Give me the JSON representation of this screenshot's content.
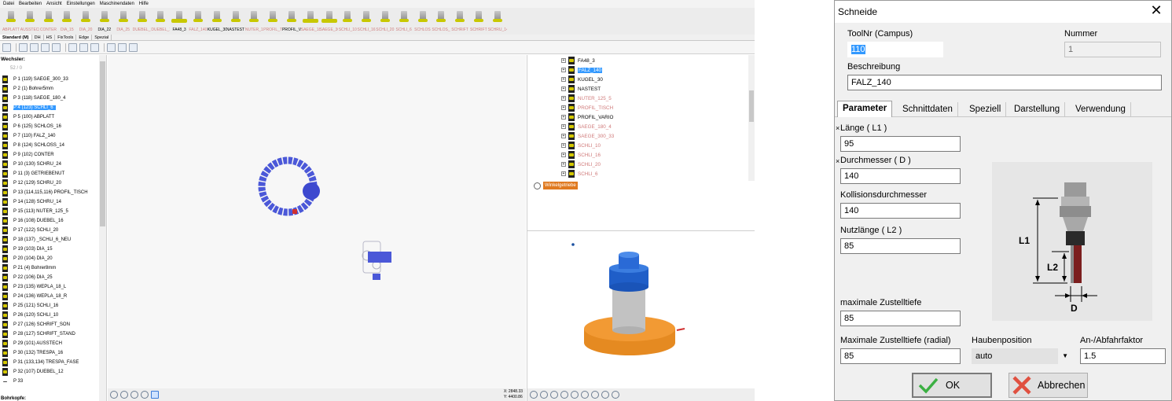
{
  "menubar": [
    "Datei",
    "Bearbeiten",
    "Ansicht",
    "Einstellungen",
    "Maschinendaten",
    "Hilfe"
  ],
  "toolstrip": [
    {
      "label": "ABPLATT",
      "dark": false
    },
    {
      "label": "AUSSTECH",
      "dark": false
    },
    {
      "label": "CONTER",
      "dark": false
    },
    {
      "label": "DIA_15",
      "dark": false
    },
    {
      "label": "DIA_20",
      "dark": false
    },
    {
      "label": "DIA_22",
      "dark": true
    },
    {
      "label": "DIA_25",
      "dark": false
    },
    {
      "label": "DUEBEL_12",
      "dark": false
    },
    {
      "label": "DUEBEL_16",
      "dark": false
    },
    {
      "label": "FA48_3",
      "dark": true
    },
    {
      "label": "FALZ_140",
      "dark": false
    },
    {
      "label": "KUGEL_30",
      "dark": true
    },
    {
      "label": "NASTEST",
      "dark": true
    },
    {
      "label": "NUTER_1",
      "dark": false
    },
    {
      "label": "PROFIL_TI",
      "dark": false
    },
    {
      "label": "PROFIL_V",
      "dark": true
    },
    {
      "label": "SAEGE_18",
      "dark": false
    },
    {
      "label": "SAEGE_30",
      "dark": false
    },
    {
      "label": "SCHLI_10",
      "dark": false
    },
    {
      "label": "SCHLI_16",
      "dark": false
    },
    {
      "label": "SCHLI_20",
      "dark": false
    },
    {
      "label": "SCHLI_6",
      "dark": false
    },
    {
      "label": "SCHLOS",
      "dark": false
    },
    {
      "label": "SCHLOS_16",
      "dark": false
    },
    {
      "label": "SCHRIFT",
      "dark": false
    },
    {
      "label": "SCHRIFT",
      "dark": false
    },
    {
      "label": "SCHRU_14",
      "dark": false
    }
  ],
  "tabrow": [
    "Standard (M)",
    "DH",
    "HS",
    "FixTools",
    "Edge",
    "Spezial"
  ],
  "left_panel": {
    "title": "Wechsler:",
    "subtitle": "52 / 0",
    "footer": "Bohrkopfe:",
    "slots": [
      "P 1 (119) SAEGE_300_33",
      "P 2 (1) Bohrer5mm",
      "P 3 (118) SAEGE_180_4",
      "P 4 (123) SCHLI_6",
      "P 5 (100) ABPLATT",
      "P 6 (125) SCHLOS_16",
      "P 7 (110) FALZ_140",
      "P 8 (124) SCHLOSS_14",
      "P 9 (102) CONTER",
      "P 10 (130) SCHRU_24",
      "P 11 (3) GETRIEBENUT",
      "P 12 (129) SCHRU_20",
      "P 13 (114,115,116) PROFIL_TISCH",
      "P 14 (128) SCHRU_14",
      "P 15 (113) NUTER_125_5",
      "P 16 (108) DUEBEL_16",
      "P 17 (122) SCHLI_20",
      "P 18 (137) _SCHLI_6_NEU",
      "P 19 (103) DIA_15",
      "P 20 (104) DIA_20",
      "P 21 (4) Bohrer8mm",
      "P 22 (106) DIA_25",
      "P 23 (135) WEPLA_18_L",
      "P 24 (136) WEPLA_18_R",
      "P 25 (121) SCHLI_16",
      "P 26 (120) SCHLI_10",
      "P 27 (126) SCHRIFT_SON",
      "P 28 (127) SCHRIFT_STAND",
      "P 29 (101) AUSSTECH",
      "P 30 (132) TRESPA_16",
      "P 31 (133,134) TRESPA_FASE",
      "P 32 (107) DUEBEL_12",
      "P 33"
    ]
  },
  "view2d": {
    "coord_x": "X: 2848.33",
    "coord_y": "Y: 4400.86"
  },
  "tree": {
    "items": [
      {
        "label": "FA48_3",
        "style": "normal"
      },
      {
        "label": "FALZ_140",
        "style": "selected"
      },
      {
        "label": "KUGEL_30",
        "style": "normal"
      },
      {
        "label": "NASTEST",
        "style": "normal"
      },
      {
        "label": "NUTER_125_5",
        "style": "pink"
      },
      {
        "label": "PROFIL_TISCH",
        "style": "pink"
      },
      {
        "label": "PROFIL_VARIO",
        "style": "normal"
      },
      {
        "label": "SAEGE_180_4",
        "style": "pink"
      },
      {
        "label": "SAEGE_300_33",
        "style": "pink"
      },
      {
        "label": "SCHLI_10",
        "style": "pink"
      },
      {
        "label": "SCHLI_16",
        "style": "pink"
      },
      {
        "label": "SCHLI_20",
        "style": "pink"
      },
      {
        "label": "SCHLI_6",
        "style": "pink"
      }
    ],
    "winkel_label": "Winkelgetriebe"
  },
  "dialog": {
    "title": "Schneide",
    "toolnr_label": "ToolNr (Campus)",
    "toolnr_value": "110",
    "nummer_label": "Nummer",
    "nummer_value": "1",
    "beschreibung_label": "Beschreibung",
    "beschreibung_value": "FALZ_140",
    "tabs": [
      "Parameter",
      "Schnittdaten",
      "Speziell",
      "Darstellung",
      "Verwendung"
    ],
    "mark": "×",
    "laenge_label": "Länge ( L1 )",
    "laenge_value": "95",
    "durchmesser_label": "Durchmesser ( D )",
    "durchmesser_value": "140",
    "kollision_label": "Kollisionsdurchmesser",
    "kollision_value": "140",
    "nutzlaenge_label": "Nutzlänge ( L2 )",
    "nutzlaenge_value": "85",
    "zustell_label": "maximale Zustelltiefe",
    "zustell_value": "85",
    "zustell_radial_label": "Maximale Zustelltiefe (radial)",
    "zustell_radial_value": "85",
    "hauben_label": "Haubenposition",
    "hauben_value": "auto",
    "faktor_label": "An-/Abfahrfaktor",
    "faktor_value": "1.5",
    "fig_l1": "L1",
    "fig_l2": "L2",
    "fig_d": "D",
    "ok_label": "OK",
    "cancel_label": "Abbrechen",
    "ok_color": "#3cb043",
    "cancel_color": "#e05040"
  }
}
